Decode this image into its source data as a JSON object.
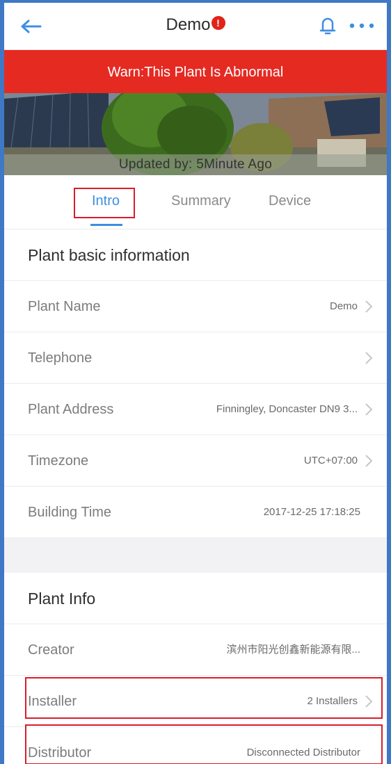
{
  "header": {
    "title": "Demo",
    "alert_badge": "!",
    "back_icon": "back-arrow-icon",
    "bell_icon": "bell-icon",
    "more_icon": "more-icon"
  },
  "banner": {
    "warning": "Warn:This Plant Is Abnormal",
    "updated": "Updated by: 5Minute Ago"
  },
  "tabs": [
    {
      "label": "Intro",
      "active": true
    },
    {
      "label": "Summary",
      "active": false
    },
    {
      "label": "Device",
      "active": false
    }
  ],
  "basic": {
    "title": "Plant basic information",
    "rows": [
      {
        "label": "Plant Name",
        "value": "Demo"
      },
      {
        "label": "Telephone",
        "value": ""
      },
      {
        "label": "Plant Address",
        "value": "Finningley, Doncaster DN9 3..."
      },
      {
        "label": "Timezone",
        "value": "UTC+07:00"
      },
      {
        "label": "Building Time",
        "value": "2017-12-25 17:18:25"
      }
    ]
  },
  "info": {
    "title": "Plant Info",
    "rows": [
      {
        "label": "Creator",
        "value": "滨州市阳光创鑫新能源有限..."
      },
      {
        "label": "Installer",
        "value": "2 Installers"
      },
      {
        "label": "Distributor",
        "value": "Disconnected Distributor"
      }
    ]
  },
  "colors": {
    "accent": "#3d8fe0",
    "warning": "#e52a22",
    "highlight_box": "#d81d2a",
    "frame": "#3f78c4"
  }
}
